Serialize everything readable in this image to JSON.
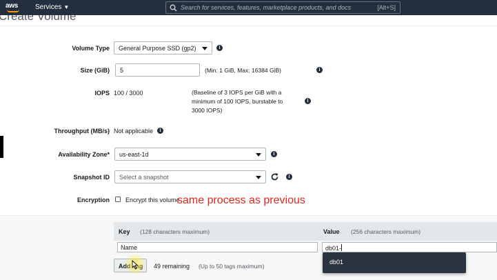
{
  "nav": {
    "logo_text": "aws",
    "services_label": "Services",
    "search_placeholder": "Search for services, features, marketplace products, and docs",
    "search_shortcut": "[Alt+S]"
  },
  "page": {
    "title": "Create Volume"
  },
  "form": {
    "volume_type": {
      "label": "Volume Type",
      "value": "General Purpose SSD (gp2)"
    },
    "size": {
      "label": "Size (GiB)",
      "value": "5",
      "hint": "(Min: 1 GiB, Max: 16384 GiB)"
    },
    "iops": {
      "label": "IOPS",
      "value": "100 / 3000",
      "hint_lines": [
        "(Baseline of 3 IOPS per GiB with a",
        "minimum of 100 IOPS, burstable to",
        "3000 IOPS)"
      ]
    },
    "throughput": {
      "label": "Throughput (MB/s)",
      "value": "Not applicable"
    },
    "availability_zone": {
      "label": "Availability Zone*",
      "value": "us-east-1d"
    },
    "snapshot": {
      "label": "Snapshot ID",
      "placeholder": "Select a snapshot"
    },
    "encryption": {
      "label": "Encryption",
      "checkbox_label": "Encrypt this volume",
      "checked": false
    }
  },
  "annotation": "same process as previous",
  "tags": {
    "key_header": "Key",
    "key_hint": "(128 characters maximum)",
    "value_header": "Value",
    "value_hint": "(256 characters maximum)",
    "row": {
      "key": "Name",
      "value": "db01-"
    },
    "suggestion": "db01",
    "add_button": "Add Tag",
    "remaining": "49 remaining",
    "max_hint": "(Up to 50 tags maximum)"
  },
  "colors": {
    "nav_bg": "#232f3e",
    "logo_accent": "#ff9900",
    "annotation": "#e4261b",
    "dropdown_bg": "#2b3340"
  }
}
